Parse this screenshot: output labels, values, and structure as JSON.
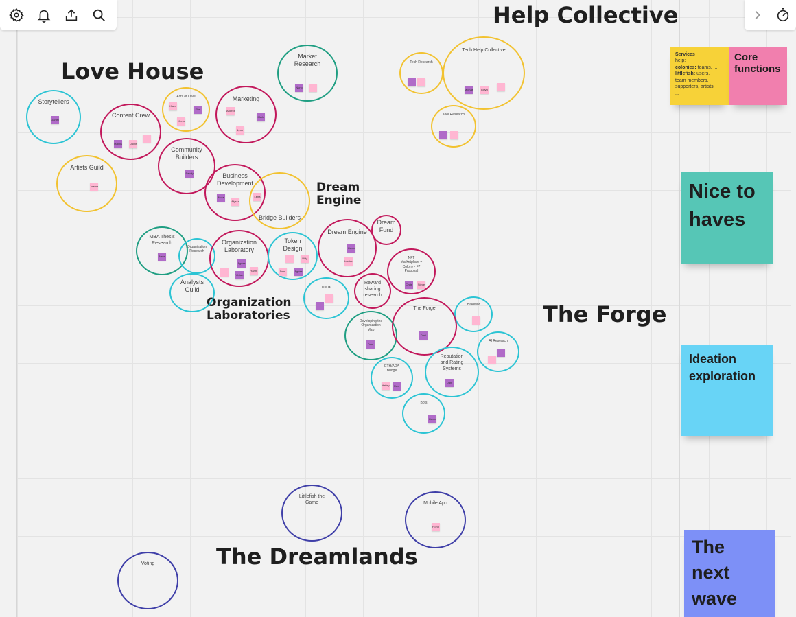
{
  "toolbar": {
    "settings": "settings-icon",
    "notifications": "bell-icon",
    "share": "upload-icon",
    "search": "search-icon",
    "collapse": "chevron-right-icon",
    "timer": "timer-icon"
  },
  "headings": {
    "help_collective": "Help Collective",
    "love_house": "Love House",
    "dream_engine": "Dream\nEngine",
    "org_labs": "Organization\nLaboratories",
    "the_forge": "The Forge",
    "dreamlands": "The Dreamlands"
  },
  "circles": {
    "market_research": "Market\nResearch",
    "tech_research": "Tech Research",
    "tech_help_collective": "Tech Help Collective",
    "tool_research": "Tool Research",
    "storytellers": "Storytellers",
    "content_crew": "Content Crew",
    "acts_of_love": "Acts of Love",
    "marketing": "Marketing",
    "community_builders": "Community\nBuilders",
    "artists_guild": "Artists Guild",
    "business_development": "Business\nDevelopment",
    "bridge_builders": "Bridge Builders",
    "mba_thesis": "MBA Thesis\nResearch",
    "org_research": "Organization\nResearch",
    "org_lab": "Organization\nLaboratory",
    "token_design": "Token\nDesign",
    "dream_engine": "Dream Engine",
    "dream_fund": "Dream\nFund",
    "analysts_guild": "Analysts\nGuild",
    "uiux": "UI/UX",
    "nft_marketplace": "NFT\nMarketplace +\nColony - F7\nProposal",
    "reward_sharing": "Reward\nsharing\nresearch",
    "bakeflor": "Bakeflor",
    "developing_org_map": "Developing the\nOrganization\nMap",
    "the_forge": "The Forge",
    "ai_research": "AI Research",
    "eth_ada_bridge": "ETH/ADA\nBridge",
    "reputation_rating": "Reputation\nand Rating\nSystems",
    "bots": "Bots",
    "littlefish_game": "Littlefish the\nGame",
    "mobile_app": "Mobile App",
    "voting": "Voting"
  },
  "notes": {
    "n_storytellers": "Daniel",
    "n_content_1": "Mathis",
    "n_content_2": "Dalbir",
    "n_acts_1": "Kiara",
    "n_acts_2": "Elle",
    "n_acts_3": "Xena",
    "n_market_research": "Nuno",
    "n_marketing_1": "Andrea",
    "n_marketing_2": "Mark",
    "n_marketing_3": "Lynn",
    "n_community": "Sandy",
    "n_artists": "Joanne",
    "n_bizdev_1": "Nora",
    "n_bizdev_2": "Alyssa",
    "n_bridge": "Lena",
    "n_tech_help_1": "Michael",
    "n_tech_help_2": "Lloyd",
    "n_mba": "Nela",
    "n_orglab_1": "Agnes",
    "n_orglab_2": "Vivian",
    "n_orglab_3": "Yanni",
    "n_token_1": "Billy",
    "n_token_2": "Dani",
    "n_token_3": "Agnes",
    "n_dream_engine_1": "Gavin",
    "n_dream_engine_2": "Louise",
    "n_nft_1": "Chris",
    "n_nft_2": "Steve",
    "n_dev_org_map": "Dani",
    "n_forge": "Dani",
    "n_eth_1": "Hailey",
    "n_eth_2": "Ravi",
    "n_reputation": "Dani",
    "n_bots": "Gavin",
    "n_mobile": "Fionn"
  },
  "stickies": {
    "services_title": "Services",
    "services_line1": "help:",
    "services_colonies_label": "colonies:",
    "services_colonies_value": " teams, ...",
    "services_littlefish_label": "littlefish:",
    "services_littlefish_value": " users,",
    "services_line4": "team members,",
    "services_line5": "supporters, artists",
    "services_line6": "...",
    "core_functions": "Core\nfunctions",
    "nice_to_haves": "Nice to\nhaves",
    "ideation_exploration": "Ideation\nexploration",
    "next_wave": "The\nnext\nwave"
  },
  "colors": {
    "crimson": "#c2185b",
    "teal": "#1f9e82",
    "cyan": "#2cc4d4",
    "yellow": "#f2c230",
    "indigo": "#3f3fa8",
    "note_purple": "#b06bc8",
    "note_pink": "#ffb6d2",
    "sticky_yellow": "#f7d238",
    "sticky_pink": "#f17fae",
    "sticky_teal": "#56c6b6",
    "sticky_blue": "#68d4f6",
    "sticky_indigo": "#7d90f7"
  }
}
